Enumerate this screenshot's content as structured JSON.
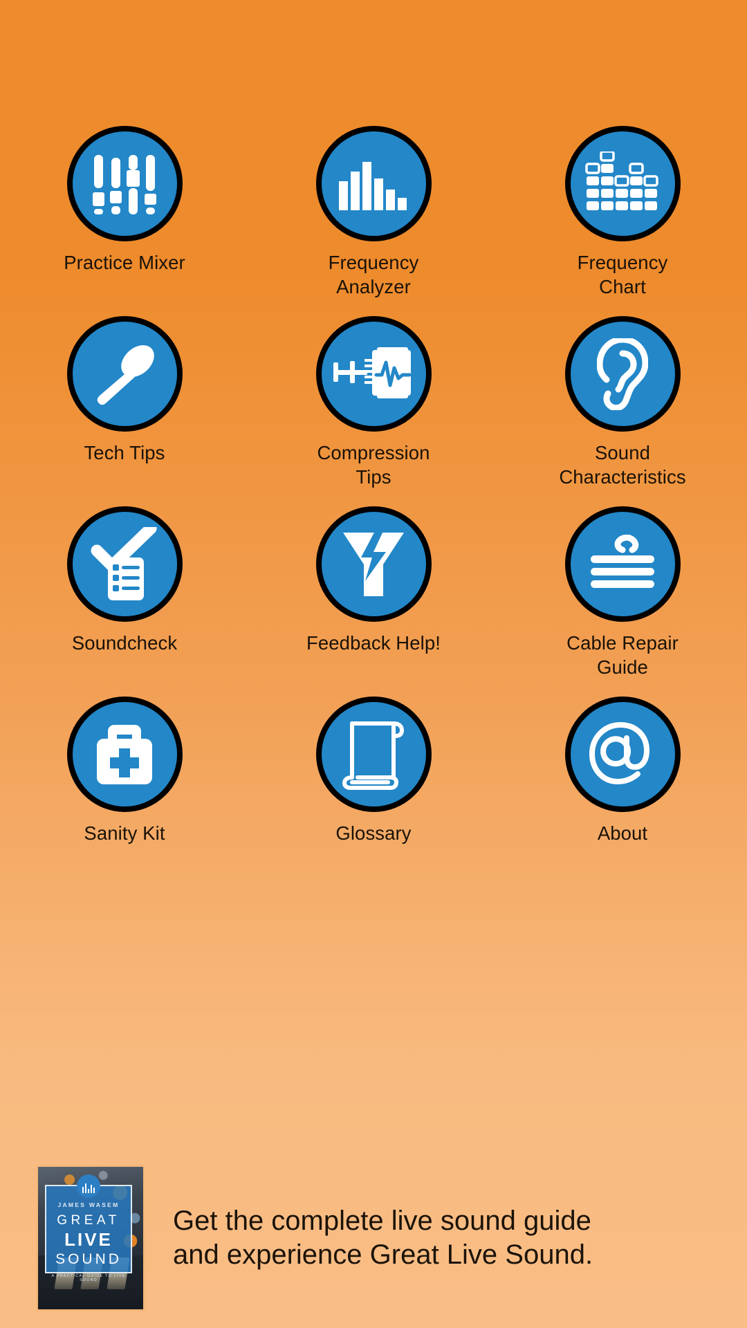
{
  "app": {
    "background_top_color": "#EE8B2C",
    "background_bottom_color": "#F9BE86",
    "icon_circle_color": "#2387C8",
    "icon_border_color": "#000000",
    "icon_glyph_color": "#FFFFFF",
    "label_color": "#1A1208"
  },
  "menu": {
    "items": [
      {
        "id": "practice-mixer",
        "icon": "mixer-faders-icon",
        "label_line1": "Practice Mixer",
        "label_line2": ""
      },
      {
        "id": "frequency-analyzer",
        "icon": "bar-spectrum-icon",
        "label_line1": "Frequency",
        "label_line2": "Analyzer"
      },
      {
        "id": "frequency-chart",
        "icon": "equalizer-grid-icon",
        "label_line1": "Frequency",
        "label_line2": "Chart"
      },
      {
        "id": "tech-tips",
        "icon": "microphone-icon",
        "label_line1": "Tech Tips",
        "label_line2": ""
      },
      {
        "id": "compression-tips",
        "icon": "clamp-waveform-icon",
        "label_line1": "Compression",
        "label_line2": "Tips"
      },
      {
        "id": "sound-characteristics",
        "icon": "ear-icon",
        "label_line1": "Sound",
        "label_line2": "Characteristics"
      },
      {
        "id": "soundcheck",
        "icon": "checklist-check-icon",
        "label_line1": "Soundcheck",
        "label_line2": ""
      },
      {
        "id": "feedback-help",
        "icon": "funnel-lightning-icon",
        "label_line1": "Feedback Help!",
        "label_line2": ""
      },
      {
        "id": "cable-repair-guide",
        "icon": "coiled-cable-icon",
        "label_line1": "Cable Repair",
        "label_line2": "Guide"
      },
      {
        "id": "sanity-kit",
        "icon": "first-aid-kit-icon",
        "label_line1": "Sanity Kit",
        "label_line2": ""
      },
      {
        "id": "glossary",
        "icon": "scroll-icon",
        "label_line1": "Glossary",
        "label_line2": ""
      },
      {
        "id": "about",
        "icon": "at-sign-icon",
        "label_line1": "About",
        "label_line2": ""
      }
    ]
  },
  "banner": {
    "text_line1": "Get the complete live sound guide",
    "text_line2": "and experience Great Live Sound.",
    "book_cover": {
      "author": "JAMES WASEM",
      "title_line1": "GREAT",
      "title_line2": "LIVE",
      "title_line3": "SOUND",
      "subtitle": "A PRACTICAL GUIDE TO LIVE SOUND"
    }
  }
}
